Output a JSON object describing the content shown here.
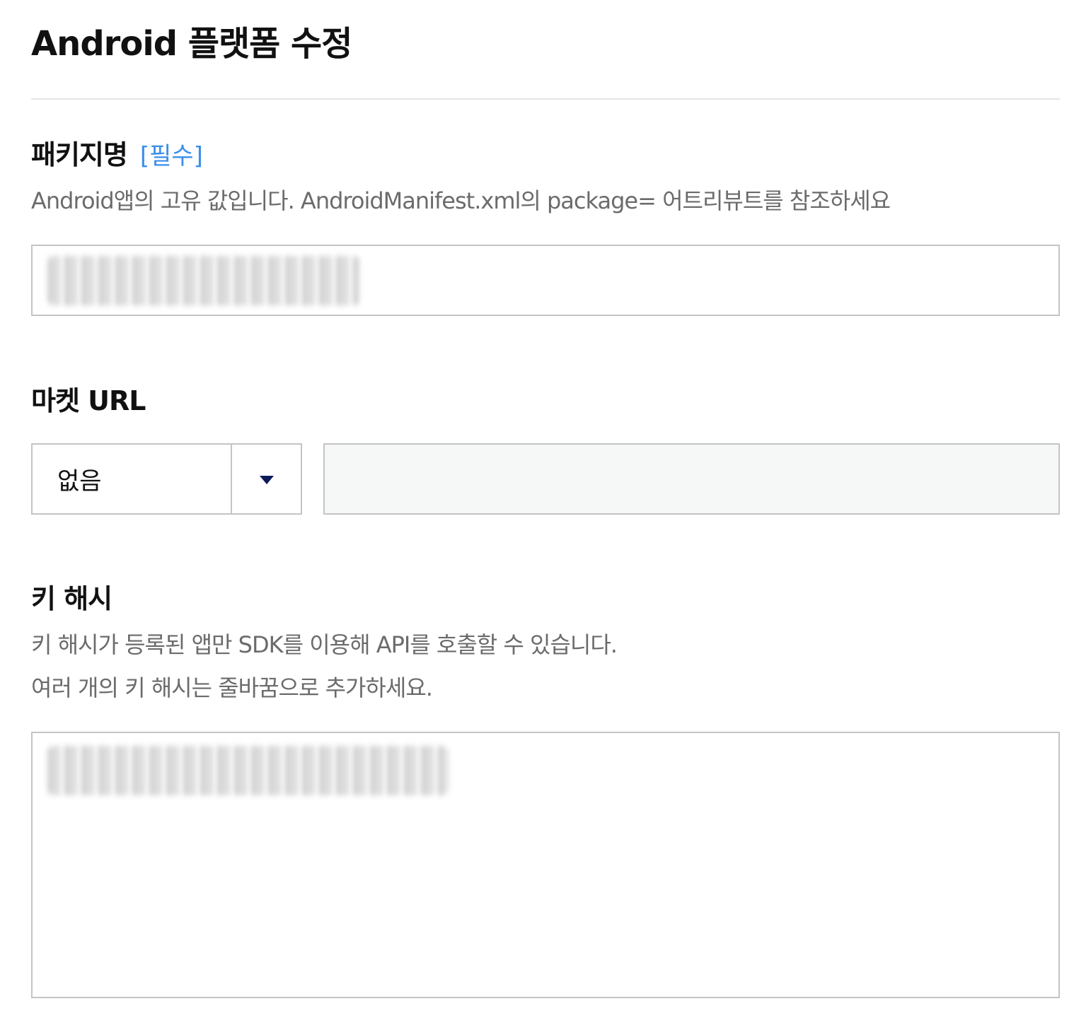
{
  "page": {
    "title": "Android 플랫폼 수정"
  },
  "package_field": {
    "label": "패키지명",
    "required_tag": "[필수]",
    "description": "Android앱의 고유 값입니다. AndroidManifest.xml의 package= 어트리뷰트를 참조하세요",
    "value_state": "redacted"
  },
  "market_url_field": {
    "label": "마켓 URL",
    "select_value": "없음",
    "url_value": "",
    "url_disabled": true
  },
  "key_hash_field": {
    "label": "키 해시",
    "description_line1": "키 해시가 등록된 앱만 SDK를 이용해 API를 호출할 수 있습니다.",
    "description_line2": "여러 개의 키 해시는 줄바꿈으로 추가하세요.",
    "value_state": "redacted"
  },
  "colors": {
    "required_accent": "#3a8eea",
    "caret": "#0c1a5c",
    "border": "#c4c4c4",
    "disabled_bg": "#f6f7f7",
    "description_text": "#6b6b6b"
  },
  "icons": {
    "select_caret": "caret-down-icon"
  }
}
